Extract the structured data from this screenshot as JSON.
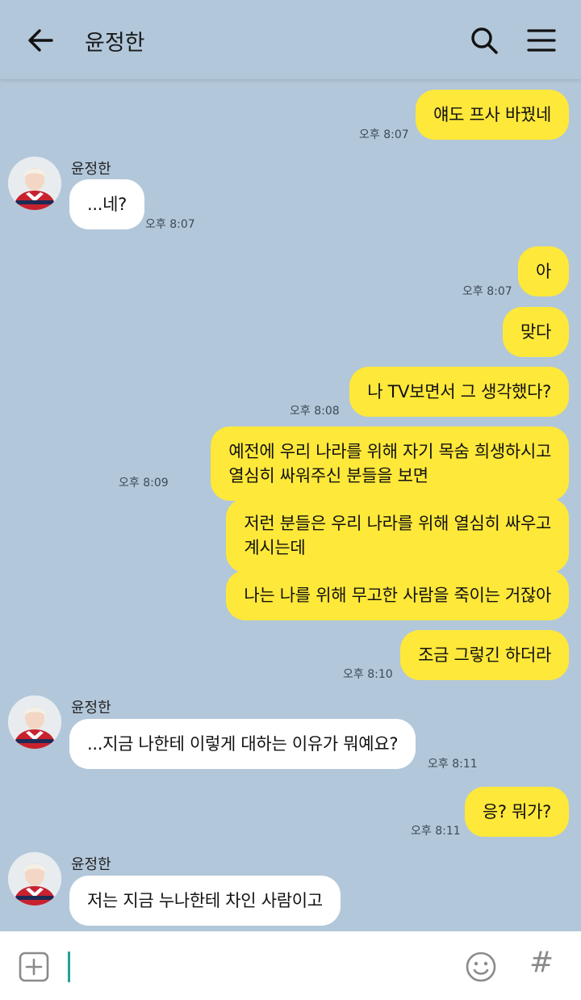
{
  "header": {
    "title": "윤정한",
    "back_icon": "arrow-left-icon",
    "search_icon": "search-icon",
    "menu_icon": "hamburger-menu-icon"
  },
  "messages": [
    {
      "from": "me",
      "text": "얘도 프사 바꿨네",
      "time": "오후 8:07"
    },
    {
      "from": "them",
      "sender": "윤정한",
      "text": "...네?",
      "time": "오후 8:07"
    },
    {
      "from": "me",
      "text": "아",
      "time": "오후 8:07"
    },
    {
      "from": "me",
      "text": "맞다",
      "time": ""
    },
    {
      "from": "me",
      "text": "나 TV보면서 그 생각했다?",
      "time": "오후 8:08"
    },
    {
      "from": "me",
      "lines": [
        "예전에 우리 나라를 위해 자기 목숨 희생하시고",
        "열심히 싸워주신 분들을 보면"
      ],
      "time": "오후 8:09"
    },
    {
      "from": "me",
      "lines": [
        "저런 분들은 우리 나라를 위해 열심히 싸우고",
        "계시는데"
      ],
      "time": ""
    },
    {
      "from": "me",
      "text": "나는 나를 위해 무고한 사람을 죽이는 거잖아",
      "time": ""
    },
    {
      "from": "me",
      "text": "조금 그렇긴 하더라",
      "time": "오후 8:10"
    },
    {
      "from": "them",
      "sender": "윤정한",
      "text": "...지금 나한테 이렇게 대하는 이유가 뭐예요?",
      "time": "오후 8:11"
    },
    {
      "from": "me",
      "text": "응? 뭐가?",
      "time": "오후 8:11"
    },
    {
      "from": "them",
      "sender": "윤정한",
      "text": "저는 지금 누나한테 차인 사람이고",
      "time": ""
    }
  ],
  "input": {
    "plus_icon": "plus-square-icon",
    "emoji_icon": "emoji-icon",
    "hash_label": "#"
  },
  "colors": {
    "background": "#b2c7da",
    "my_bubble": "#fee83a",
    "their_bubble": "#ffffff",
    "caret": "#23a394"
  }
}
